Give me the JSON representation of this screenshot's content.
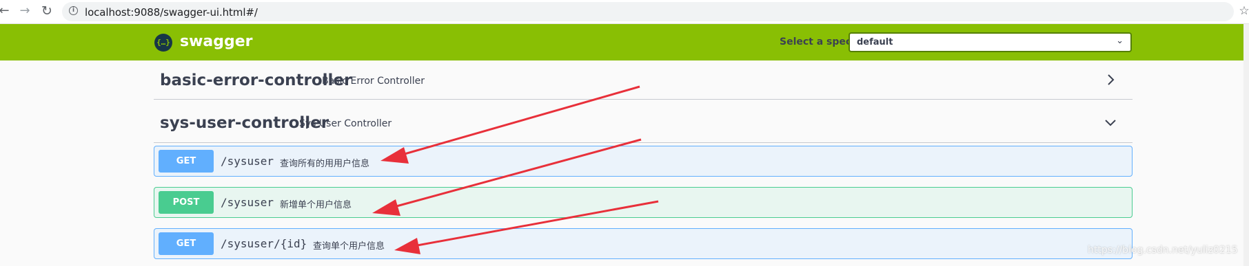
{
  "browser": {
    "back_icon": "back-arrow-icon",
    "forward_icon": "forward-arrow-icon",
    "reload_icon": "reload-icon",
    "star_icon": "bookmark-star-icon",
    "back_glyph": "←",
    "forward_glyph": "→",
    "reload_glyph": "↻",
    "info_glyph": "i",
    "star_glyph": "☆",
    "url": "localhost:9088/swagger-ui.html#/"
  },
  "topbar": {
    "logo_glyph": "{…}",
    "brand": "swagger",
    "spec_label": "Select a spec",
    "spec_value": "default",
    "spec_chevron": "⌄",
    "colors": {
      "topbar_bg": "#89bf04",
      "select_border": "#547f00"
    }
  },
  "tags": [
    {
      "name": "basic-error-controller",
      "description": "Basic Error Controller",
      "state": "collapsed"
    },
    {
      "name": "sys-user-controller",
      "description": "Sys User Controller",
      "state": "expanded"
    }
  ],
  "operations": [
    {
      "method": "GET",
      "path": "/sysuser",
      "summary": "查询所有的用用户信息"
    },
    {
      "method": "POST",
      "path": "/sysuser",
      "summary": "新增单个用户信息"
    },
    {
      "method": "GET",
      "path": "/sysuser/{id}",
      "summary": "查询单个用户信息"
    }
  ],
  "colors": {
    "get": "#61affe",
    "get_bg": "#ebf3fb",
    "post": "#49cc90",
    "post_bg": "#e8f6f0",
    "annotation_arrow": "#e8303a"
  },
  "watermark": "https://blog.csdn.net/yuliz0215"
}
